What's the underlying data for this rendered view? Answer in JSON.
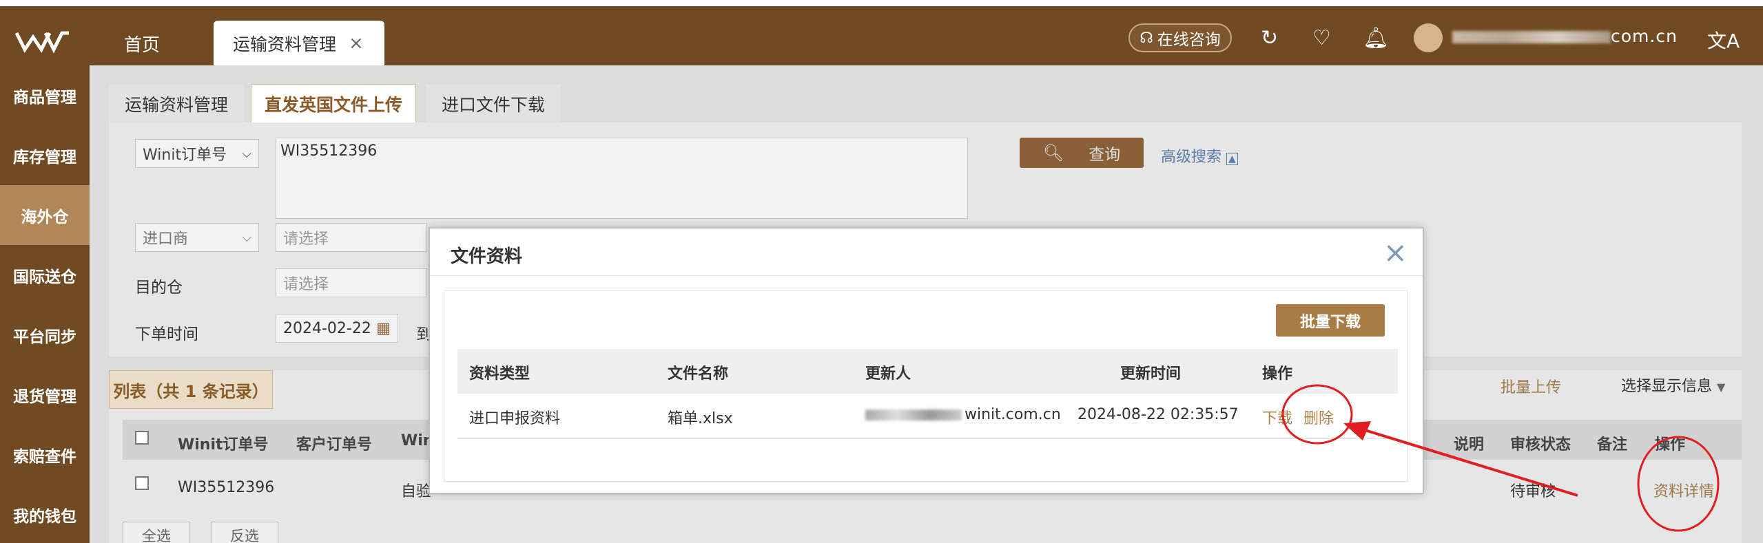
{
  "header": {
    "home_label": "首页",
    "active_tab": "运输资料管理",
    "tab_close": "×",
    "chat_label": "在线咨询",
    "user_name_suffix": "com.cn",
    "lang_icon": "文A"
  },
  "sidebar": {
    "items": [
      {
        "label": "商品管理"
      },
      {
        "label": "库存管理"
      },
      {
        "label": "海外仓"
      },
      {
        "label": "国际送仓"
      },
      {
        "label": "平台同步"
      },
      {
        "label": "退货管理"
      },
      {
        "label": "索赔查件"
      },
      {
        "label": "我的钱包"
      }
    ],
    "active_index": 2
  },
  "subtabs": [
    {
      "label": "运输资料管理"
    },
    {
      "label": "直发英国文件上传"
    },
    {
      "label": "进口文件下载"
    }
  ],
  "search": {
    "type_select": "Winit订单号",
    "order_value": "WI35512396",
    "importer_select": "进口商",
    "importer_placeholder": "请选择",
    "dest_label": "目的仓",
    "dest_placeholder": "请选择",
    "date_label": "下单时间",
    "date_from": "2024-02-22",
    "date_to_label": "到",
    "search_button": "查询",
    "advanced_search": "高级搜索"
  },
  "list": {
    "tab_label": "列表（共 1 条记录）",
    "batch_upload": "批量上传",
    "display_info": "选择显示信息",
    "columns": [
      "Winit订单号",
      "客户订单号",
      "Win",
      "说明",
      "审核状态",
      "备注",
      "操作"
    ],
    "row": {
      "order_no": "WI35512396",
      "col3": "自验",
      "status": "待审核",
      "action": "资料详情"
    },
    "select_all": "全选",
    "invert": "反选"
  },
  "modal": {
    "title": "文件资料",
    "close": "×",
    "batch_download": "批量下载",
    "columns": [
      "资料类型",
      "文件名称",
      "更新人",
      "更新时间",
      "操作"
    ],
    "rows": [
      {
        "type": "进口申报资料",
        "file_name": "箱单.xlsx",
        "updater_suffix": "winit.com.cn",
        "updated_at": "2024-08-22 02:35:57",
        "download": "下载",
        "delete": "删除"
      }
    ]
  },
  "colors": {
    "brand": "#6f4a22",
    "accent": "#a97b45",
    "annotation": "#e02020"
  }
}
